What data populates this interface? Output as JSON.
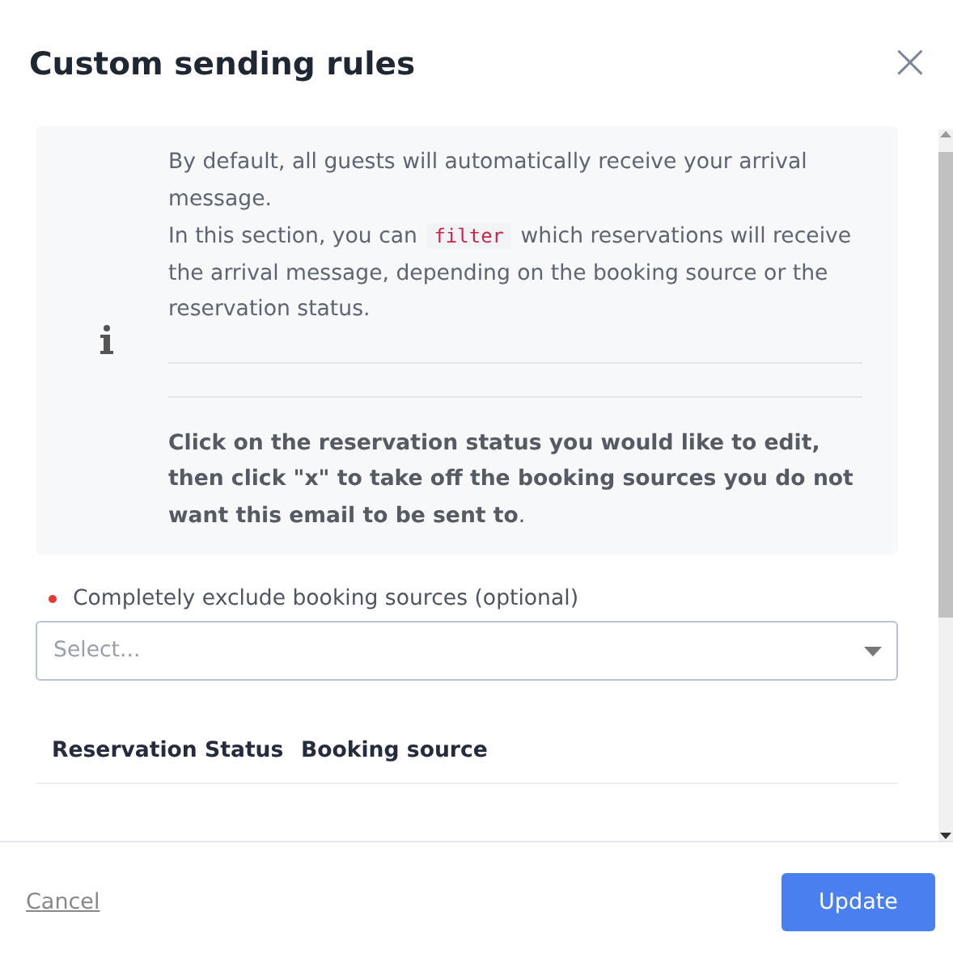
{
  "dialog": {
    "title": "Custom sending rules",
    "close": "×"
  },
  "info": {
    "first": "By default, all guests will automatically receive your arrival message.",
    "second_before": "In this section, you can ",
    "second_code": "filter",
    "second_after": " which reservations will receive the arrival message, depending on the booking source or the reservation status.",
    "note": "**Click on the reservation status you would like to edit, then click \"x\" to take off the booking sources you do not want this email to be sent to**."
  },
  "exclude": {
    "label": "Completely exclude booking sources (optional)",
    "placeholder": "Select..."
  },
  "table": {
    "columns": [
      "Reservation Status",
      "Booking source"
    ]
  },
  "footer": {
    "cancel": "Cancel",
    "submit": "Update"
  }
}
